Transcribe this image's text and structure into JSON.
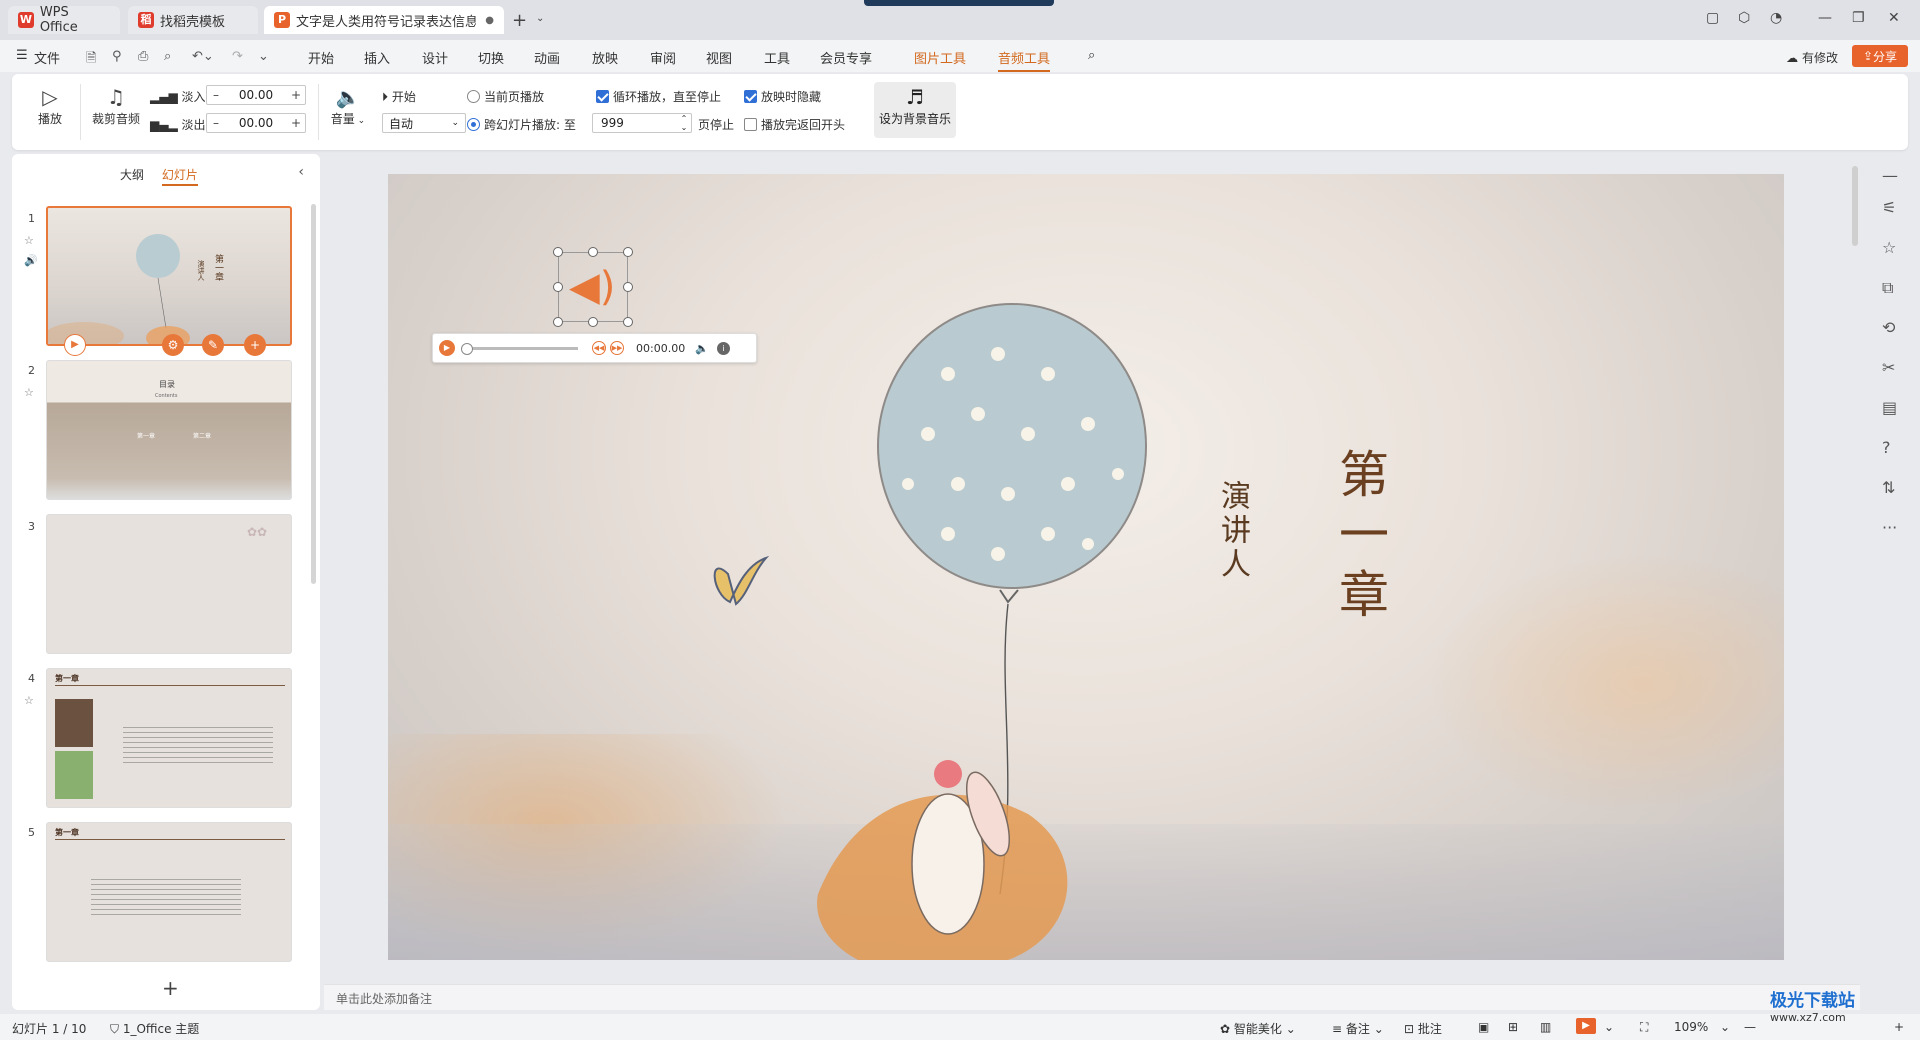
{
  "tabs": {
    "wps": "WPS Office",
    "template": "找稻壳模板",
    "document": "文字是人类用符号记录表达信息以..."
  },
  "menu": {
    "file": "文件",
    "items": [
      "开始",
      "插入",
      "设计",
      "切换",
      "动画",
      "放映",
      "审阅",
      "视图",
      "工具",
      "会员专享"
    ],
    "picture_tools": "图片工具",
    "audio_tools": "音频工具",
    "modified": "有修改",
    "share": "分享"
  },
  "ribbon": {
    "play": "播放",
    "trim_audio": "裁剪音频",
    "fade_in_label": "淡入:",
    "fade_in_value": "00.00",
    "fade_out_label": "淡出:",
    "fade_out_value": "00.00",
    "volume": "音量",
    "start_label": "开始",
    "start_value": "自动",
    "current_page_play": "当前页播放",
    "cross_slide_play": "跨幻灯片播放: 至",
    "cross_slide_value": "999",
    "page_stop": "页停止",
    "loop_play": "循环播放，直至停止",
    "hide_during_show": "放映时隐藏",
    "rewind_after_play": "播放完返回开头",
    "set_bg_music": "设为背景音乐"
  },
  "left_panel": {
    "tab_outline": "大纲",
    "tab_slides": "幻灯片",
    "slides": [
      {
        "num": "1",
        "title": "第一章",
        "subtitle": "演讲人"
      },
      {
        "num": "2",
        "title": "目录",
        "subtitle": "Contents",
        "items": [
          "第一章",
          "第二章"
        ]
      },
      {
        "num": "3"
      },
      {
        "num": "4",
        "title": "第一章"
      },
      {
        "num": "5",
        "title": "第一章"
      }
    ]
  },
  "slide": {
    "title": "第一章",
    "speaker": "演讲人"
  },
  "audio_player": {
    "time": "00:00.00"
  },
  "notes_placeholder": "单击此处添加备注",
  "status": {
    "slide_counter": "幻灯片 1 / 10",
    "theme": "1_Office 主题",
    "smart_beautify": "智能美化",
    "notes": "备注",
    "comments": "批注",
    "zoom": "109%"
  },
  "watermark": {
    "brand": "极光下载站",
    "site": "www.xz7.com"
  },
  "colors": {
    "accent": "#e8773a",
    "title_brown": "#6a4020",
    "checkbox_blue": "#2f6fd6"
  }
}
